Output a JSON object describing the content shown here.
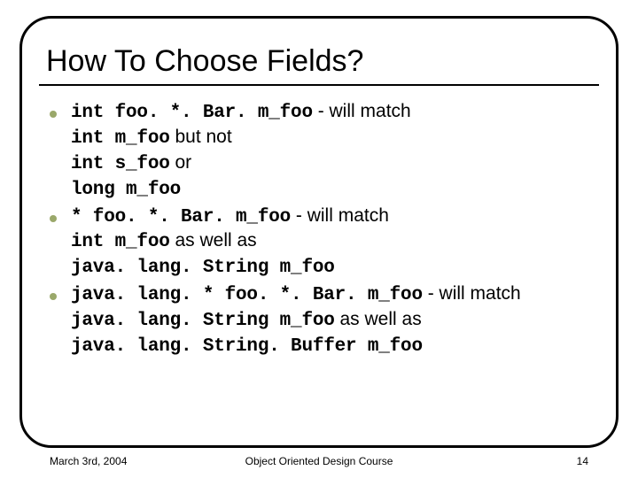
{
  "title": "How To Choose Fields?",
  "bullets": [
    {
      "pattern": "int foo. *. Bar. m_foo",
      "connector1": " - will match",
      "line2_code": "int m_foo",
      "line2_text": " but not",
      "line3_code": "int s_foo",
      "line3_text": " or",
      "line4_code": "long m_foo"
    },
    {
      "pattern": "* foo. *. Bar. m_foo",
      "connector1": " - will match",
      "line2_code": "int m_foo",
      "line2_text": " as well as",
      "line3_code": "java. lang. String m_foo"
    },
    {
      "pattern": "java. lang. * foo. *. Bar. m_foo",
      "connector1": " - will match",
      "line2_code": "java. lang. String m_foo",
      "line2_text": " as well as",
      "line3_code": "java. lang. String. Buffer m_foo"
    }
  ],
  "footer": {
    "date": "March 3rd, 2004",
    "course": "Object Oriented Design Course",
    "page": "14"
  }
}
